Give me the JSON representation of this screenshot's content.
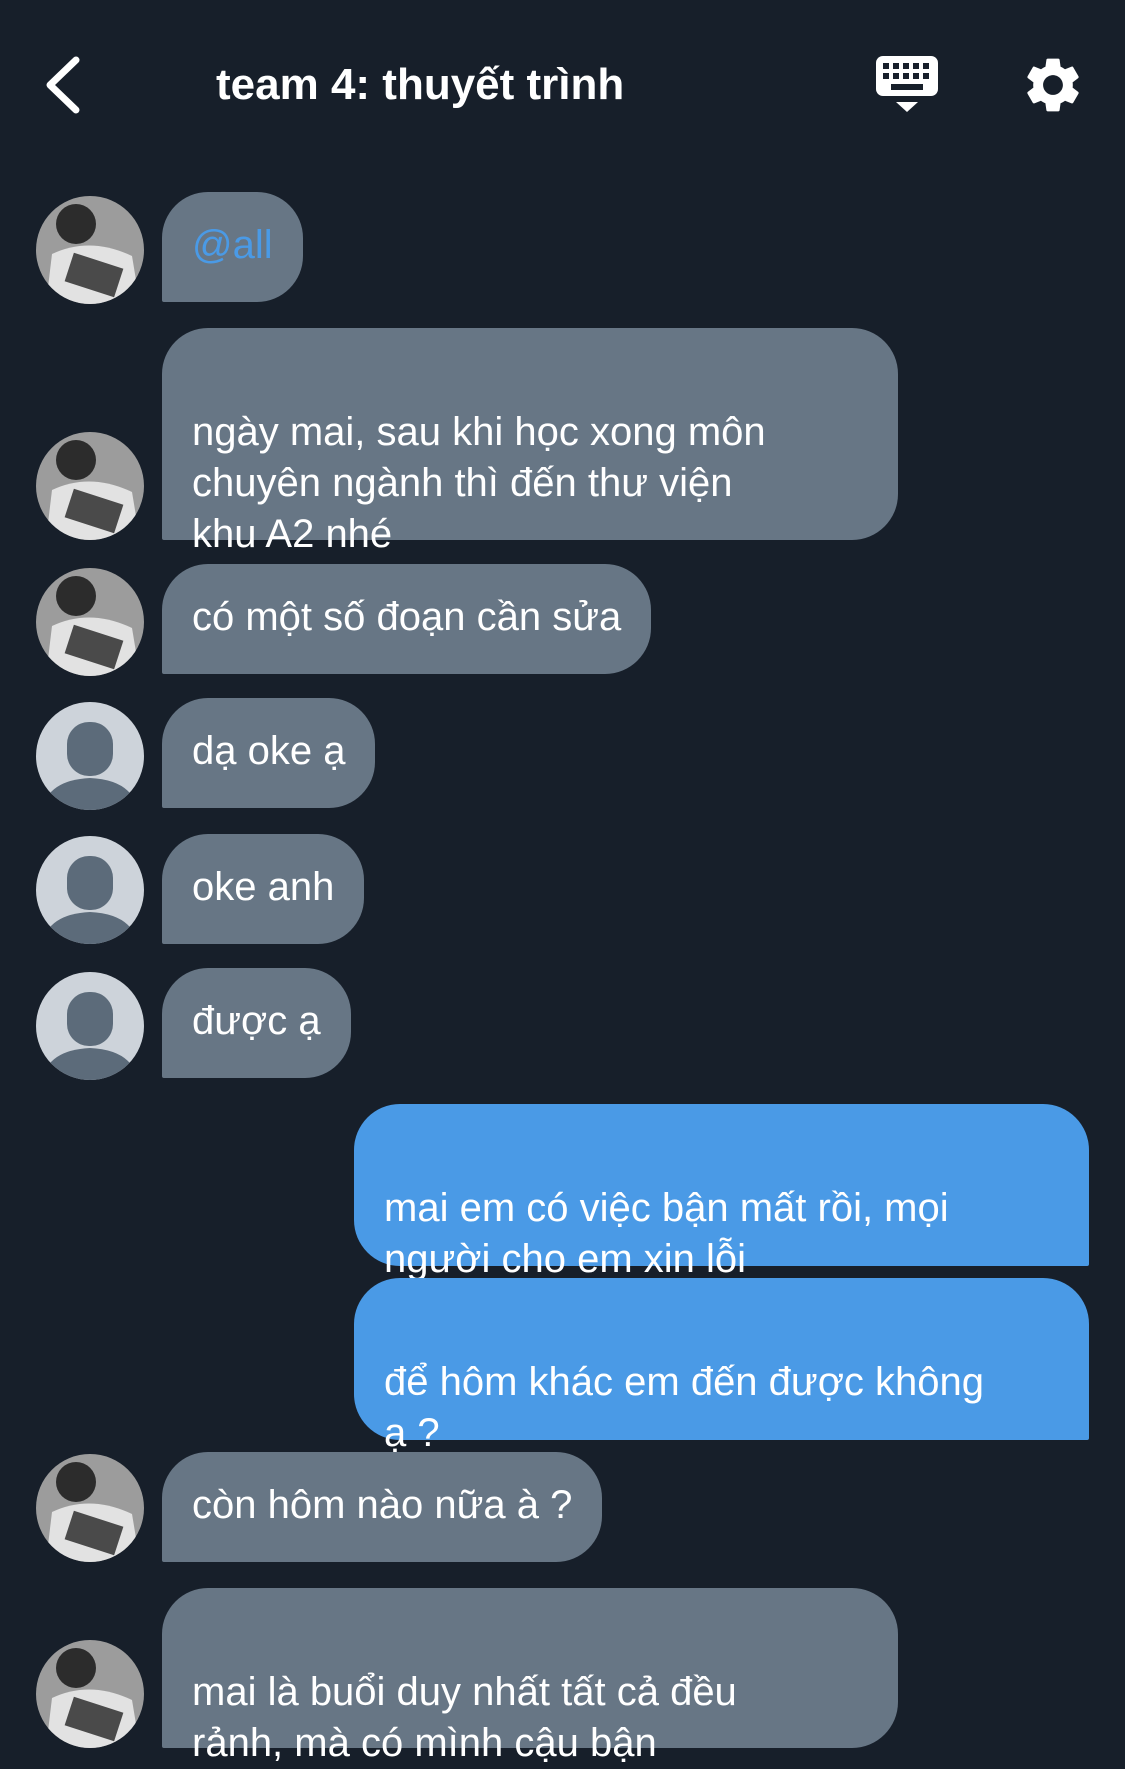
{
  "header": {
    "title": "team 4: thuyết trình",
    "back_icon": "chevron-left-icon",
    "keyboard_icon": "keyboard-icon",
    "settings_icon": "gear-icon"
  },
  "colors": {
    "background": "#171f2a",
    "incoming_bubble": "#677685",
    "outgoing_bubble": "#4a9ae6",
    "mention": "#4a9ae6"
  },
  "messages": [
    {
      "direction": "incoming",
      "sender": "photo",
      "text": "@all"
    },
    {
      "direction": "incoming",
      "sender": "photo",
      "text": "ngày mai, sau khi học xong môn\nchuyên ngành thì đến thư viện\nkhu A2 nhé"
    },
    {
      "direction": "incoming",
      "sender": "photo",
      "text": "có một số đoạn cần sửa"
    },
    {
      "direction": "incoming",
      "sender": "default",
      "text": "dạ oke ạ"
    },
    {
      "direction": "incoming",
      "sender": "default",
      "text": "oke anh"
    },
    {
      "direction": "incoming",
      "sender": "default",
      "text": "được ạ"
    },
    {
      "direction": "outgoing",
      "text": "mai em có việc bận mất rồi, mọi\nngười cho em xin lỗi"
    },
    {
      "direction": "outgoing",
      "text": "để hôm khác em đến được không\nạ ?"
    },
    {
      "direction": "incoming",
      "sender": "photo",
      "text": "còn hôm nào nữa à ?"
    },
    {
      "direction": "incoming",
      "sender": "photo",
      "text": "mai là buổi duy nhất tất cả đều\nrảnh, mà có mình cậu bận"
    }
  ]
}
